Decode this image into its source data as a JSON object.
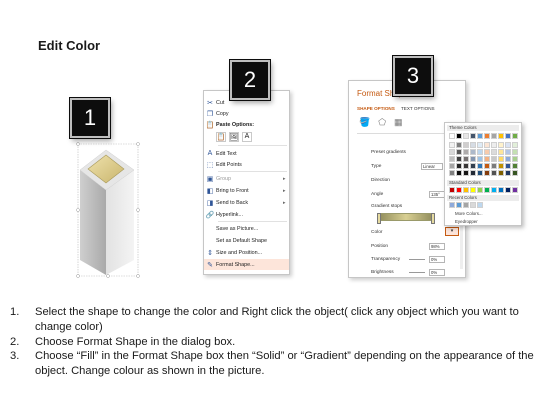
{
  "page": {
    "title": "Edit Color"
  },
  "badges": [
    "1",
    "2",
    "3"
  ],
  "context_menu": {
    "items": [
      {
        "label": "Cut",
        "icon": "scissors-icon",
        "submenu": false
      },
      {
        "label": "Copy",
        "icon": "copy-icon",
        "submenu": false
      },
      {
        "label": "Paste Options:",
        "icon": "paste-icon",
        "submenu": false
      },
      {
        "label": "Edit Text",
        "icon": "edit-text-icon",
        "submenu": false
      },
      {
        "label": "Edit Points",
        "icon": "edit-points-icon",
        "submenu": false
      },
      {
        "label": "Group",
        "icon": "group-icon",
        "submenu": true
      },
      {
        "label": "Bring to Front",
        "icon": "bring-to-front-icon",
        "submenu": true
      },
      {
        "label": "Send to Back",
        "icon": "send-to-back-icon",
        "submenu": true
      },
      {
        "label": "Hyperlink...",
        "icon": "hyperlink-icon",
        "submenu": false
      },
      {
        "label": "Save as Picture...",
        "icon": "",
        "submenu": false
      },
      {
        "label": "Set as Default Shape",
        "icon": "",
        "submenu": false
      },
      {
        "label": "Size and Position...",
        "icon": "size-position-icon",
        "submenu": false
      },
      {
        "label": "Format Shape...",
        "icon": "format-shape-icon",
        "submenu": false
      }
    ]
  },
  "format_pane": {
    "title": "Format Shape",
    "tabs": [
      "SHAPE OPTIONS",
      "TEXT OPTIONS"
    ],
    "fields": {
      "preset_gradients": "Preset gradients",
      "type": "Type",
      "type_value": "Linear",
      "direction": "Direction",
      "angle": "Angle",
      "angle_value": "135°",
      "gradient_stops": "Gradient stops",
      "color": "Color",
      "position": "Position",
      "position_value": "98%",
      "transparency": "Transparency",
      "transparency_value": "0%",
      "brightness": "Brightness",
      "brightness_value": "0%"
    }
  },
  "color_palette": {
    "theme_label": "Theme Colors",
    "standard_label": "Standard Colors",
    "recent_label": "Recent Colors",
    "more_colors": "More Colors...",
    "eyedropper": "Eyedropper",
    "theme_top": [
      "#ffffff",
      "#000000",
      "#e7e6e6",
      "#44546a",
      "#5b9bd5",
      "#ed7d31",
      "#a5a5a5",
      "#ffc000",
      "#4472c4",
      "#70ad47"
    ],
    "theme_shades": [
      [
        "#f2f2f2",
        "#7f7f7f",
        "#d0cece",
        "#d6dce4",
        "#deebf6",
        "#fbe5d5",
        "#ededed",
        "#fff2cc",
        "#dae3f3",
        "#e2efd9"
      ],
      [
        "#d8d8d8",
        "#595959",
        "#aeabab",
        "#adb9ca",
        "#bdd7ee",
        "#f7cbac",
        "#dbdbdb",
        "#fee599",
        "#b4c6e7",
        "#c5e0b3"
      ],
      [
        "#bfbfbf",
        "#3f3f3f",
        "#757070",
        "#8496b0",
        "#9dc3e6",
        "#f4b183",
        "#c9c9c9",
        "#ffd965",
        "#8eaadb",
        "#a8d08d"
      ],
      [
        "#a5a5a5",
        "#262626",
        "#3a3838",
        "#323f4f",
        "#2e75b5",
        "#c55a11",
        "#7b7b7b",
        "#bf9000",
        "#2f5496",
        "#538135"
      ],
      [
        "#7f7f7f",
        "#0c0c0c",
        "#171616",
        "#222a35",
        "#1e4e79",
        "#843c0c",
        "#525252",
        "#7f6000",
        "#203864",
        "#375623"
      ]
    ],
    "standard": [
      "#c00000",
      "#ff0000",
      "#ffc000",
      "#ffff00",
      "#92d050",
      "#00b050",
      "#00b0f0",
      "#0070c0",
      "#002060",
      "#7030a0"
    ],
    "recent": [
      "#8eaadb",
      "#5b9bd5",
      "#a5a5a5",
      "#d9d9d9",
      "#bdd7ee"
    ]
  },
  "instructions": [
    {
      "num": "1.",
      "text": "Select the shape to change the color and Right click the object( click any object which you want to change color)"
    },
    {
      "num": "2.",
      "text": "Choose Format Shape in the dialog box."
    },
    {
      "num": "3.",
      "text": "Choose “Fill” in the Format Shape box then “Solid” or “Gradient” depending on the appearance of the object. Change colour as shown in the picture."
    }
  ],
  "colors": {
    "accent": "#c55a11",
    "badge_bg": "#0d0d0d",
    "shape_gold": "#d9c98a",
    "highlight": "#fde5da"
  }
}
